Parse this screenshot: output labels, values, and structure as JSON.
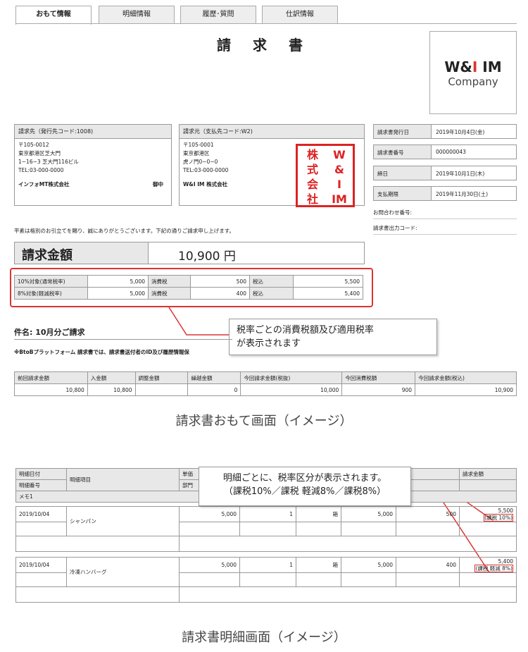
{
  "tabs": [
    "おもて情報",
    "明細情報",
    "履歴･質問",
    "仕訳情報"
  ],
  "title": "請 求 書",
  "logo": {
    "line1a": "W&",
    "line1b": "I",
    "line1c": " IM",
    "line2": "Company"
  },
  "billto": {
    "header": "請求先（発行先コード:1008)",
    "zip": "〒105-0012",
    "addr1": "東京都港区芝大門",
    "addr2": "1−16−3 芝大門116ビル",
    "tel": "TEL:03-000-0000",
    "name": "インフォMT株式会社",
    "honorific": "御中"
  },
  "billfrom": {
    "header": "請求元（支払先コード:W2)",
    "zip": "〒105-0001",
    "addr1": "東京都港区",
    "addr2": "虎ノ門0−0−0",
    "tel": "TEL:03-000-0000",
    "name": "W&I IM 株式会社"
  },
  "stamp": [
    "株",
    "式",
    "会",
    "社",
    "W",
    "&",
    "I",
    "IM"
  ],
  "meta": [
    {
      "k": "請求書発行日",
      "v": "2019年10月4日(金)"
    },
    {
      "k": "請求書番号",
      "v": "000000043"
    },
    {
      "k": "締日",
      "v": "2019年10月1日(木)"
    },
    {
      "k": "支払期限",
      "v": "2019年11月30日(土)"
    }
  ],
  "inquiry": "お問合わせ番号:",
  "outcode": "請求書出力コード:",
  "greeting": "平素は格別のお引立てを賜り、誠にありがとうございます。下記の通りご請求申し上げます。",
  "amount": {
    "label": "請求金額",
    "value": "10,900 円"
  },
  "taxrows": [
    {
      "l": "10%対象(通常税率)",
      "base": "5,000",
      "tl": "消費税",
      "tax": "500",
      "il": "税込",
      "inc": "5,500"
    },
    {
      "l": "8%対象(軽減税率)",
      "base": "5,000",
      "tl": "消費税",
      "tax": "400",
      "il": "税込",
      "inc": "5,400"
    }
  ],
  "callout1": [
    "税率ごとの消費税額及び適用税率",
    "が表示されます"
  ],
  "subject": "件名: 10月分ご請求",
  "btob": "※BtoBプラットフォーム 請求書では、請求書送付者のID及び履歴情報保",
  "sum": {
    "headers": [
      "前回請求金額",
      "入金額",
      "調整金額",
      "繰越金額",
      "今回請求金額(税抜)",
      "今回消費税額",
      "今回請求金額(税込)"
    ],
    "values": [
      "10,800",
      "10,800",
      "",
      "0",
      "10,000",
      "900",
      "10,900"
    ]
  },
  "cap1": "請求書おもて画面（イメージ）",
  "detail": {
    "h_date": "明細日付",
    "h_no": "明細番号",
    "h_item": "明細項目",
    "h_price": "単価",
    "h_dept": "部門",
    "h_amt": "額",
    "h_total": "請求金額",
    "h_memo": "メモ1",
    "rows": [
      {
        "date": "2019/10/04",
        "item": "シャンパン",
        "price": "5,000",
        "qty": "1",
        "unit": "箱",
        "amount": "5,000",
        "tax": "500",
        "total": "5,500",
        "taxnote": "(課税 10%)"
      },
      {
        "date": "2019/10/04",
        "item": "冷凍ハンバーグ",
        "price": "5,000",
        "qty": "1",
        "unit": "箱",
        "amount": "5,000",
        "tax": "400",
        "total": "5,400",
        "taxnote": "(課税 軽減 8%)"
      }
    ]
  },
  "callout2": [
    "明細ごとに、税率区分が表示されます。",
    "（課税10%／課税 軽減8%／課税8%）"
  ],
  "cap2": "請求書明細画面（イメージ）",
  "colors": {
    "red": "#dd3333",
    "gray": "#e8e8e8"
  }
}
